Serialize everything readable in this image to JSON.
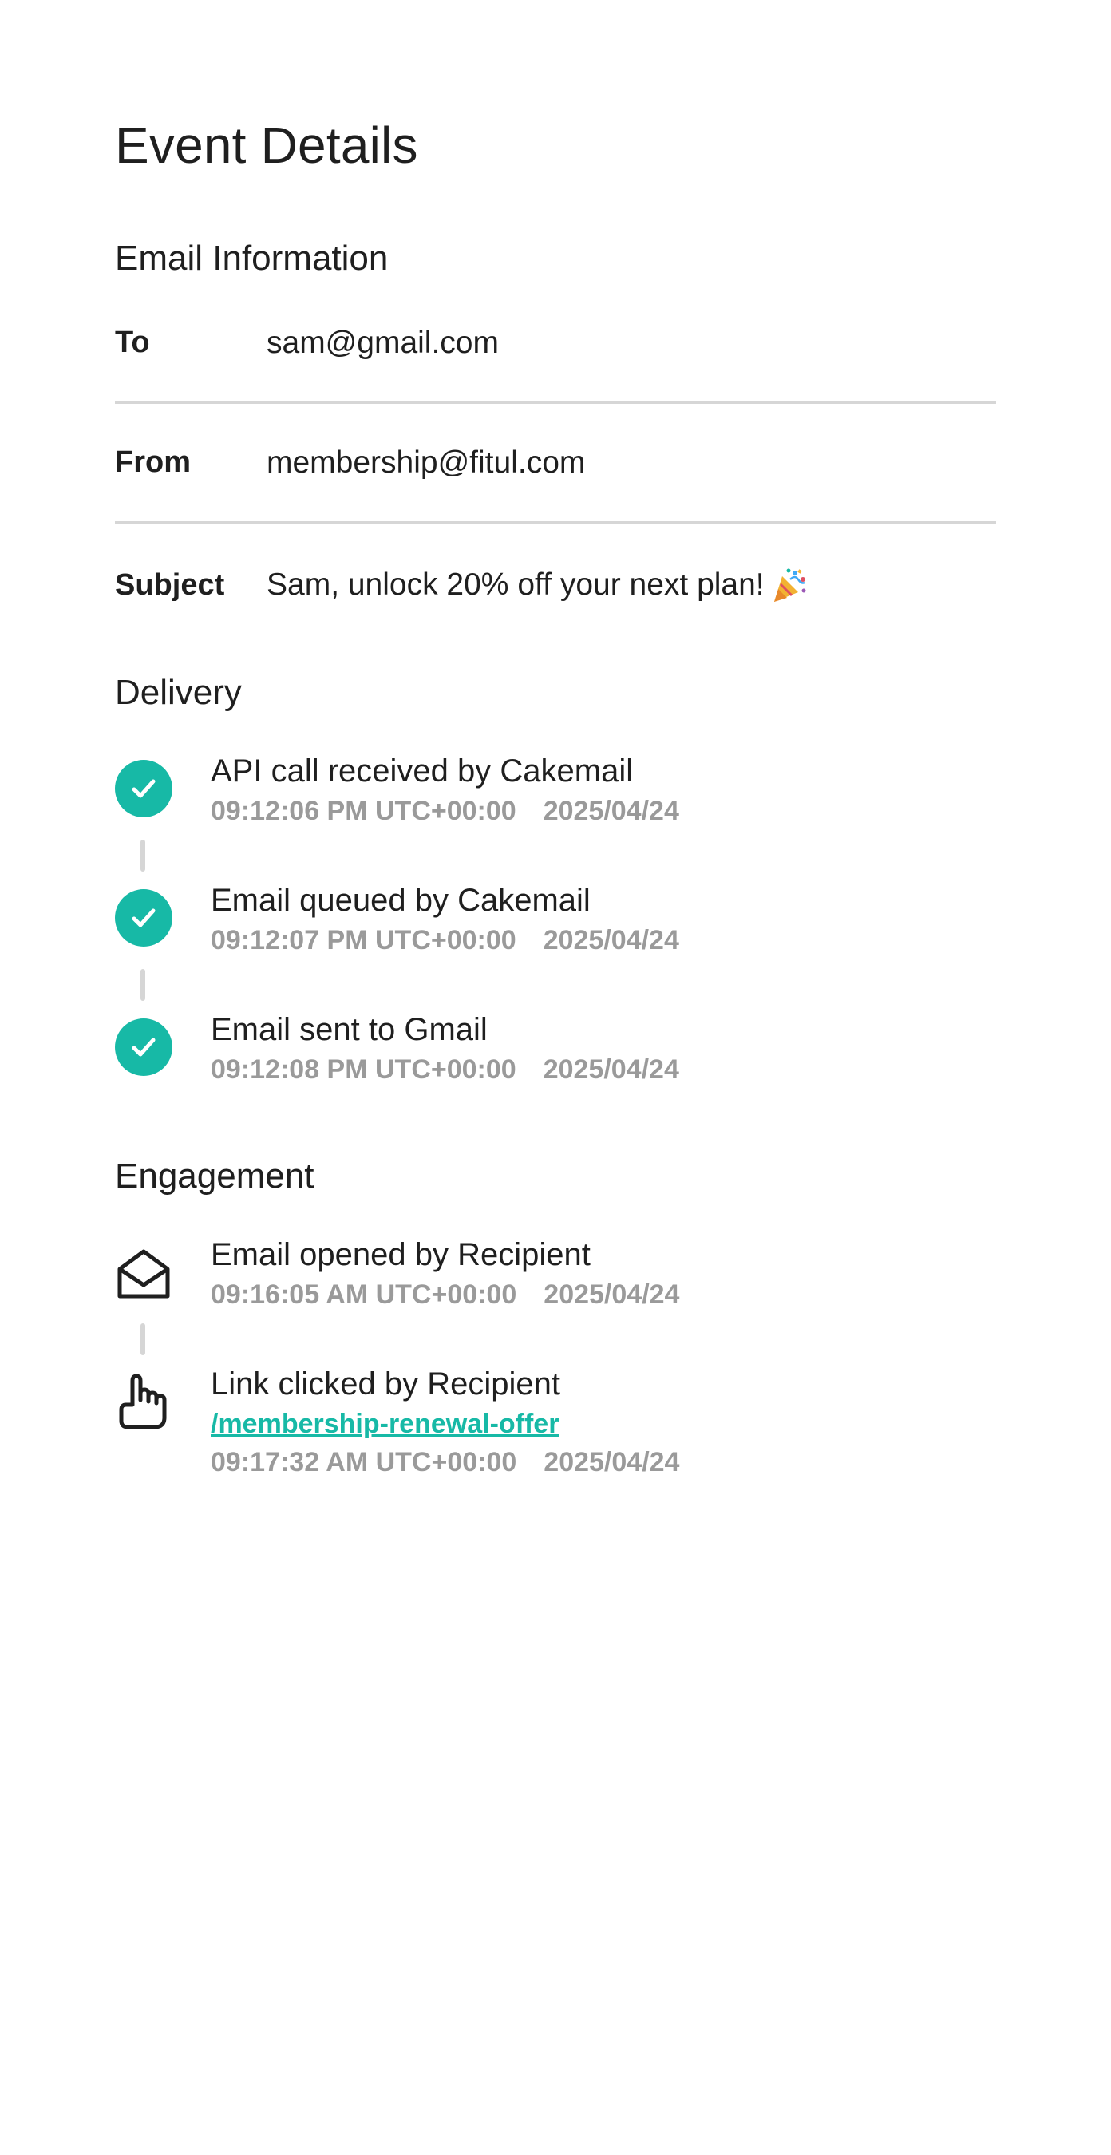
{
  "page_title": "Event Details",
  "email_info": {
    "section_title": "Email Information",
    "rows": [
      {
        "label": "To",
        "value": "sam@gmail.com"
      },
      {
        "label": "From",
        "value": "membership@fitul.com"
      },
      {
        "label": "Subject",
        "value": "Sam, unlock 20% off your next plan!",
        "icon": "party-popper-icon"
      }
    ]
  },
  "delivery": {
    "section_title": "Delivery",
    "events": [
      {
        "title": "API call received by Cakemail",
        "time": "09:12:06 PM UTC+00:00",
        "date": "2025/04/24",
        "icon": "check-circle-icon"
      },
      {
        "title": "Email queued by Cakemail",
        "time": "09:12:07 PM UTC+00:00",
        "date": "2025/04/24",
        "icon": "check-circle-icon"
      },
      {
        "title": "Email sent to Gmail",
        "time": "09:12:08 PM UTC+00:00",
        "date": "2025/04/24",
        "icon": "check-circle-icon"
      }
    ]
  },
  "engagement": {
    "section_title": "Engagement",
    "events": [
      {
        "title": "Email opened by Recipient",
        "time": "09:16:05 AM UTC+00:00",
        "date": "2025/04/24",
        "icon": "open-envelope-icon"
      },
      {
        "title": "Link clicked by Recipient",
        "link": "/membership-renewal-offer",
        "time": "09:17:32 AM UTC+00:00",
        "date": "2025/04/24",
        "icon": "pointing-hand-icon"
      }
    ]
  },
  "colors": {
    "accent": "#17b9a6",
    "text": "#1f1f1f",
    "muted": "#9a9a9a",
    "divider": "#d6d6d6"
  }
}
